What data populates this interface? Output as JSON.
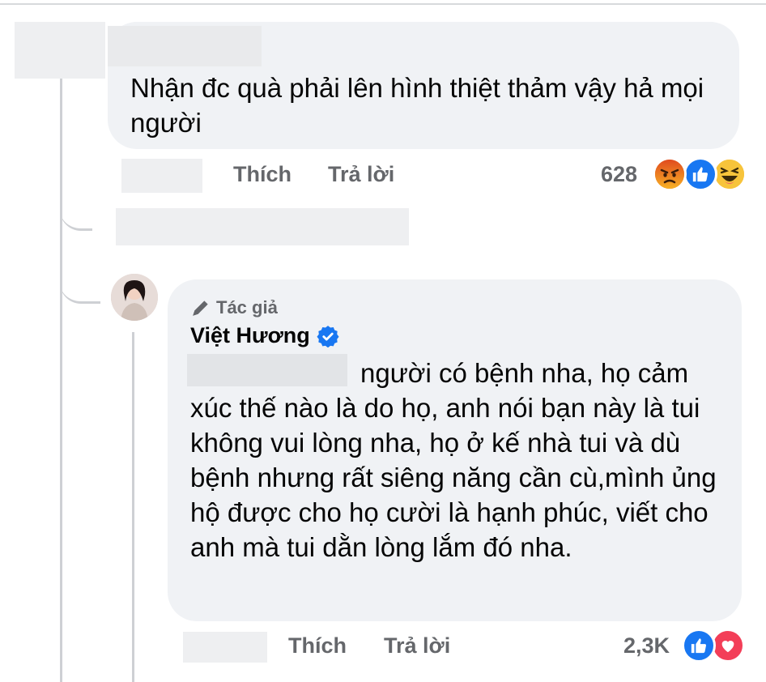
{
  "comment1": {
    "text": "Nhận đc quà phải lên hình thiệt thảm vậy hả mọi người",
    "like_label": "Thích",
    "reply_label": "Trả lời",
    "reaction_count": "628",
    "reactions": [
      "angry-icon",
      "like-icon",
      "haha-icon"
    ]
  },
  "reply": {
    "author_tag": "Tác giả",
    "author_name": "Việt Hương",
    "verified": true,
    "text": "người có bệnh nha, họ cảm xúc thế nào là do họ, anh nói bạn này là tui không vui lòng nha, họ ở kế nhà tui và dù bệnh nhưng rất siêng năng cần cù,mình ủng hộ được cho họ cười là hạnh phúc, viết cho anh mà tui dằn lòng lắm đó nha.",
    "like_label": "Thích",
    "reply_label": "Trả lời",
    "reaction_count": "2,3K",
    "reactions": [
      "like-icon",
      "love-icon"
    ]
  },
  "colors": {
    "bubble": "#f0f2f5",
    "like_blue": "#1877f2",
    "love_red": "#f33e58",
    "muted_text": "#65676b",
    "verified_blue": "#1877f2"
  }
}
